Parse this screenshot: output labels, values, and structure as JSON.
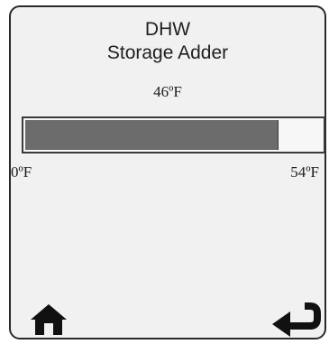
{
  "screen": {
    "title_line1": "DHW",
    "title_line2": "Storage Adder",
    "current_value": "46ºF",
    "progress": {
      "value": 46,
      "min": 0,
      "max": 54,
      "min_label": "0ºF",
      "max_label": "54ºF"
    }
  },
  "nav": {
    "home_icon": "home-icon",
    "back_icon": "return-arrow-icon"
  },
  "colors": {
    "fill": "#6c6c6c",
    "background": "#f1f1f1",
    "border": "#2a2a2a"
  }
}
